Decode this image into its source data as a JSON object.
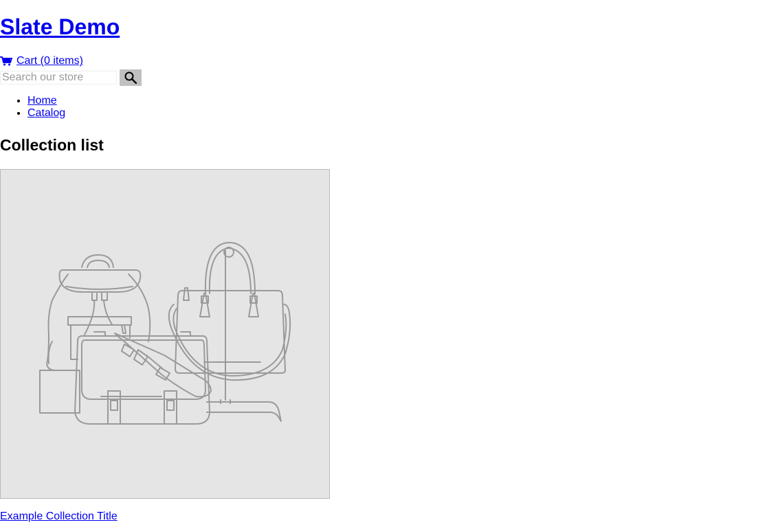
{
  "header": {
    "site_title": "Slate Demo",
    "cart_label": "Cart (0 items)",
    "search_placeholder": "Search our store"
  },
  "nav": {
    "items": [
      {
        "label": "Home"
      },
      {
        "label": "Catalog"
      }
    ]
  },
  "main": {
    "section_title": "Collection list",
    "collections": [
      {
        "title": "Example Collection Title",
        "image_icon": "bags-illustration"
      }
    ]
  },
  "colors": {
    "link": "#0000ee",
    "image_bg": "#e5e5e5",
    "search_button_bg": "#c0c0c0"
  }
}
